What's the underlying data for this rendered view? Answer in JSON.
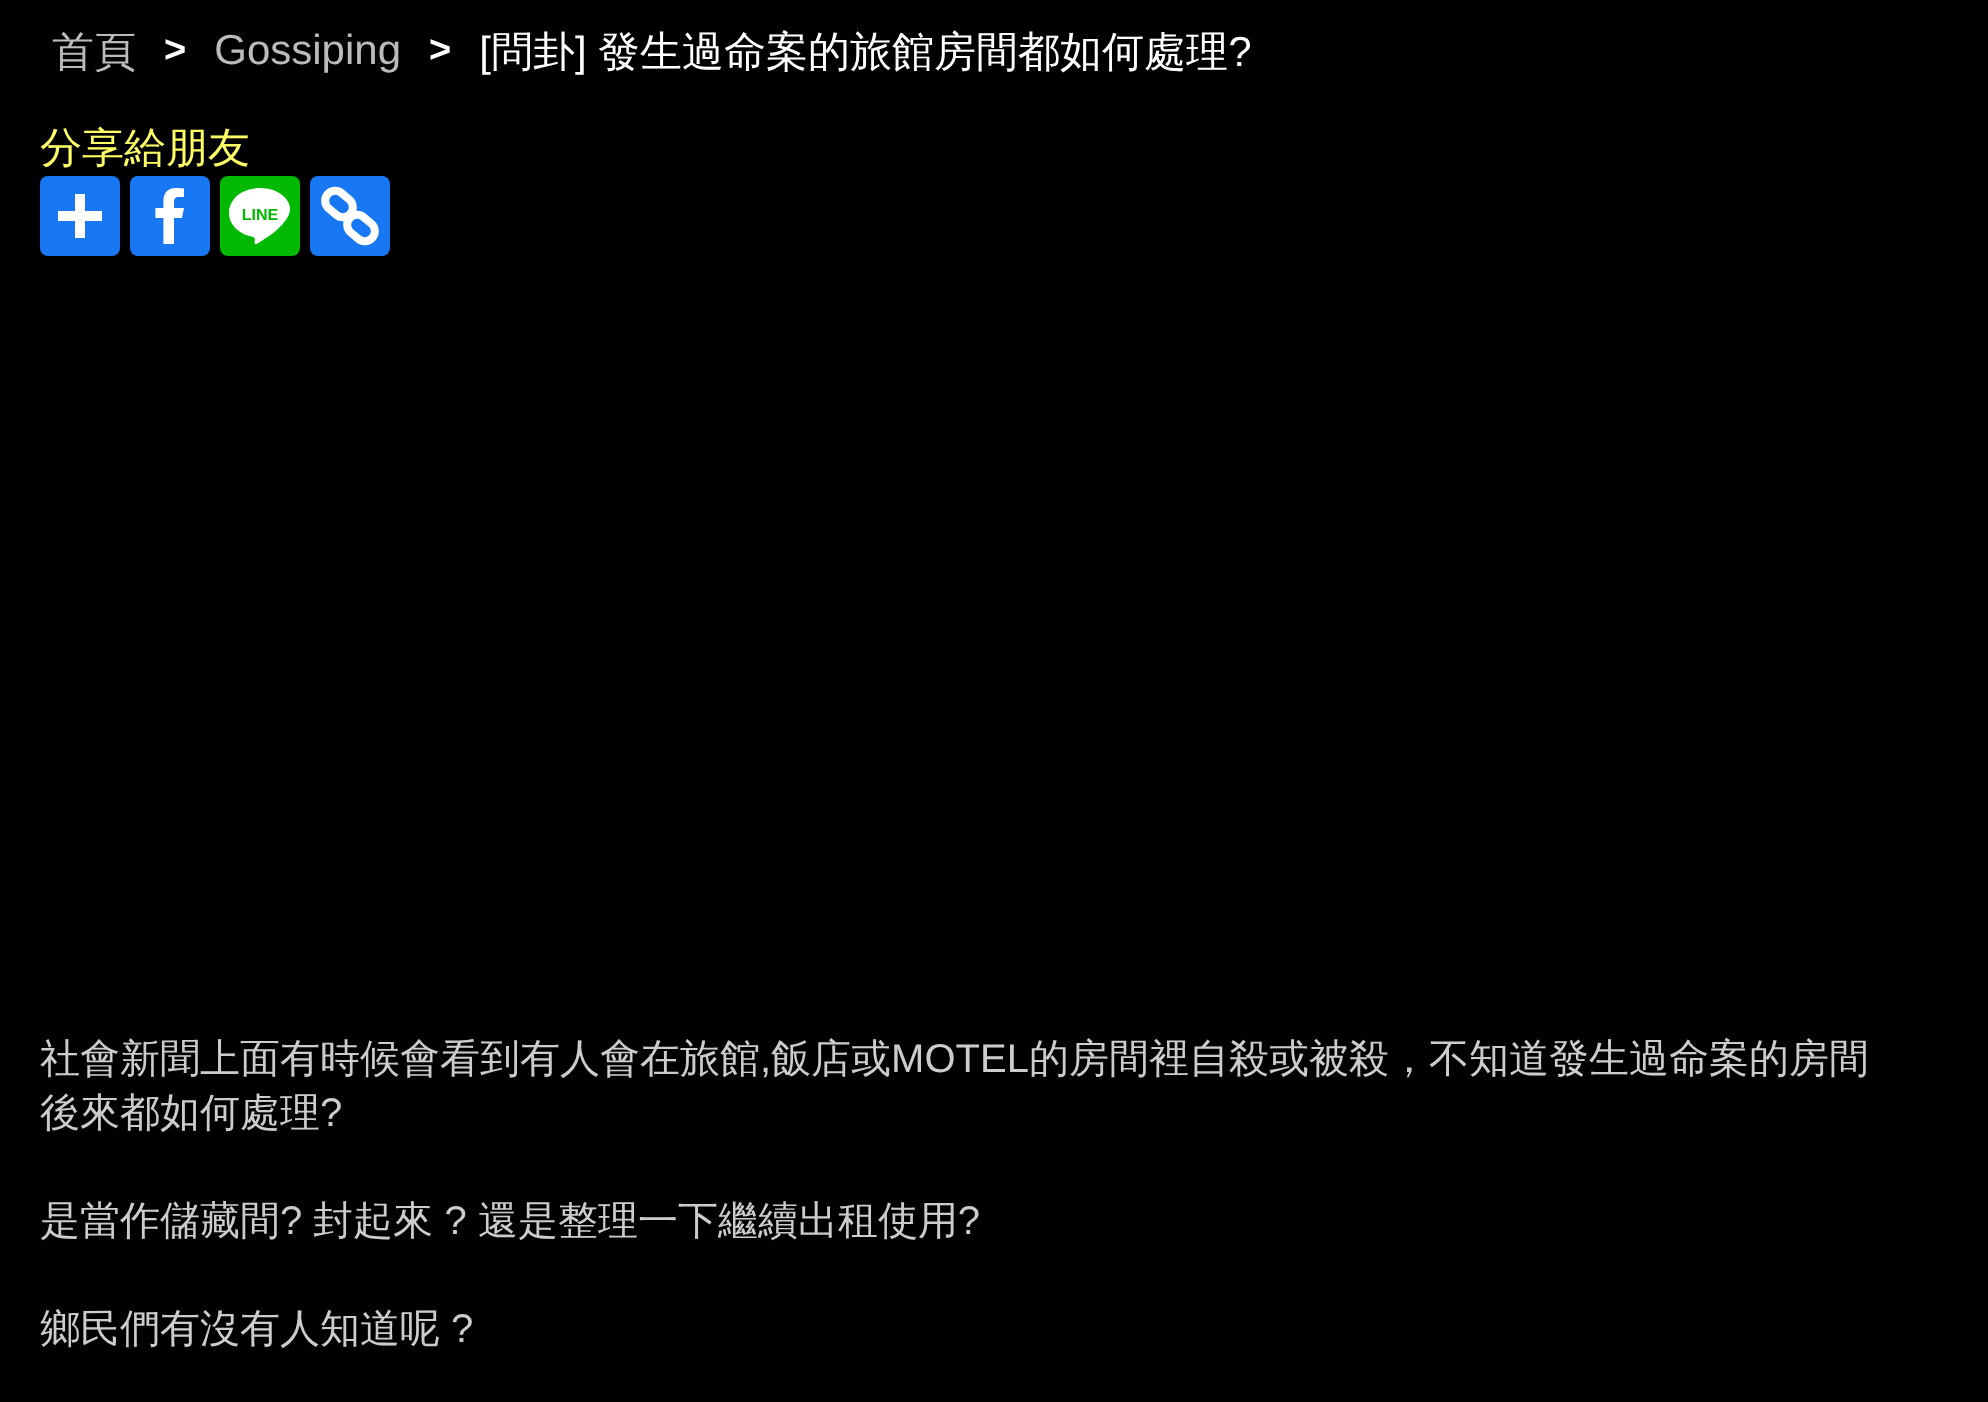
{
  "breadcrumb": [
    {
      "kind": "link",
      "label": "首頁"
    },
    {
      "kind": "link",
      "label": "Gossiping"
    },
    {
      "kind": "current",
      "label": "[問卦] 發生過命案的旅館房間都如何處理?"
    }
  ],
  "breadcrumb_separator": ">",
  "share": {
    "label": "分享給朋友",
    "buttons": [
      {
        "kind": "plus"
      },
      {
        "kind": "facebook"
      },
      {
        "kind": "line",
        "text": "LINE"
      },
      {
        "kind": "link"
      }
    ]
  },
  "paragraphs": [
    "社會新聞上面有時候會看到有人會在旅館,飯店或MOTEL的房間裡自殺或被殺，不知道發生過命案的房間後來都如何處理?",
    "是當作儲藏間? 封起來 ? 還是整理一下繼續出租使用?",
    "鄉民們有沒有人知道呢 ?"
  ]
}
